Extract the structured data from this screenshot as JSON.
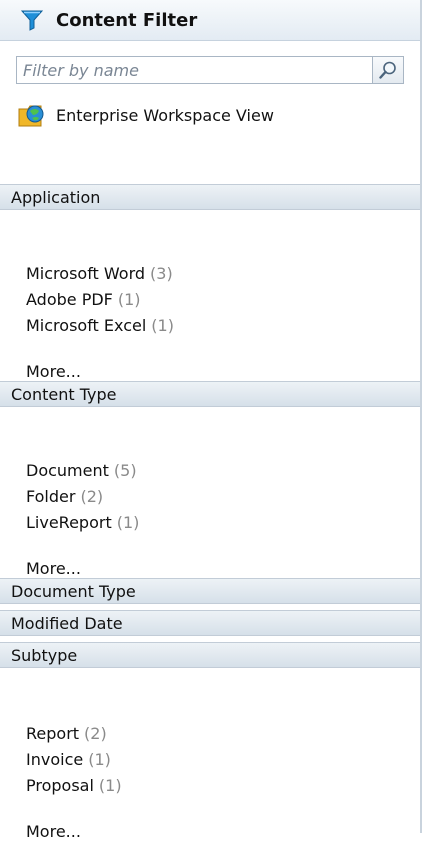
{
  "header": {
    "title": "Content Filter",
    "icon": "funnel-icon"
  },
  "filter": {
    "placeholder": "Filter by name",
    "value": ""
  },
  "workspace": {
    "label": "Enterprise Workspace View",
    "icon": "workspace-folder-icon"
  },
  "sections": {
    "application": {
      "title": "Application",
      "items": [
        {
          "label": "Microsoft Word",
          "count": "(3)"
        },
        {
          "label": "Adobe PDF",
          "count": "(1)"
        },
        {
          "label": "Microsoft Excel",
          "count": "(1)"
        }
      ],
      "more": "More..."
    },
    "content_type": {
      "title": "Content Type",
      "items": [
        {
          "label": "Document",
          "count": "(5)"
        },
        {
          "label": "Folder",
          "count": "(2)"
        },
        {
          "label": "LiveReport",
          "count": "(1)"
        }
      ],
      "more": "More..."
    },
    "document_type": {
      "title": "Document Type"
    },
    "modified_date": {
      "title": "Modified Date"
    },
    "subtype": {
      "title": "Subtype",
      "items": [
        {
          "label": "Report",
          "count": "(2)"
        },
        {
          "label": "Invoice",
          "count": "(1)"
        },
        {
          "label": "Proposal",
          "count": "(1)"
        }
      ],
      "more": "More..."
    }
  },
  "colors": {
    "accent": "#1f8fd8",
    "header_bg": "#e3ebf3",
    "count_text": "#8a8a8a"
  }
}
